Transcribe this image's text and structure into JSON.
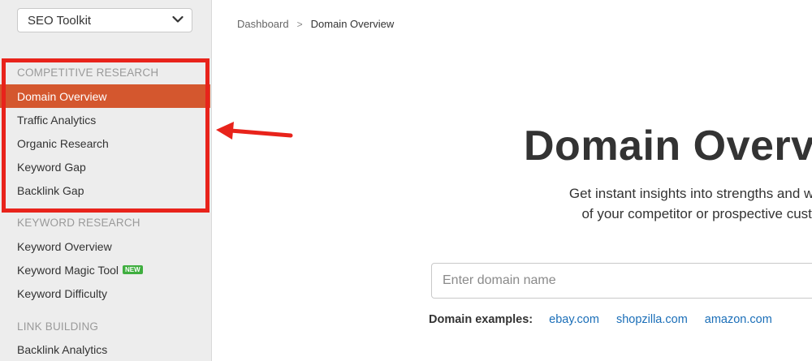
{
  "sidebar": {
    "toolkit_select": "SEO Toolkit",
    "sections": [
      {
        "heading": "COMPETITIVE RESEARCH",
        "items": [
          "Domain Overview",
          "Traffic Analytics",
          "Organic Research",
          "Keyword Gap",
          "Backlink Gap"
        ]
      },
      {
        "heading": "KEYWORD RESEARCH",
        "items": [
          "Keyword Overview",
          "Keyword Magic Tool",
          "Keyword Difficulty"
        ],
        "badge": "NEW"
      },
      {
        "heading": "LINK BUILDING",
        "items": [
          "Backlink Analytics"
        ]
      }
    ],
    "active_item": "Domain Overview"
  },
  "breadcrumb": {
    "root": "Dashboard",
    "separator": ">",
    "current": "Domain Overview"
  },
  "main": {
    "title": "Domain Overvi",
    "subtitle_line1": "Get instant insights into strengths and weakn",
    "subtitle_line2": "of your competitor or prospective custom",
    "search_placeholder": "Enter domain name",
    "examples_label": "Domain examples:",
    "examples": [
      "ebay.com",
      "shopzilla.com",
      "amazon.com"
    ]
  },
  "colors": {
    "active_item_bg": "#d4572e",
    "annotation_red": "#e8231b",
    "link_blue": "#1a6eb8",
    "badge_green": "#3fae3f"
  },
  "icons": {
    "toolkit_chevron": "chevron-down-icon",
    "annotation": "red-arrow-icon"
  }
}
